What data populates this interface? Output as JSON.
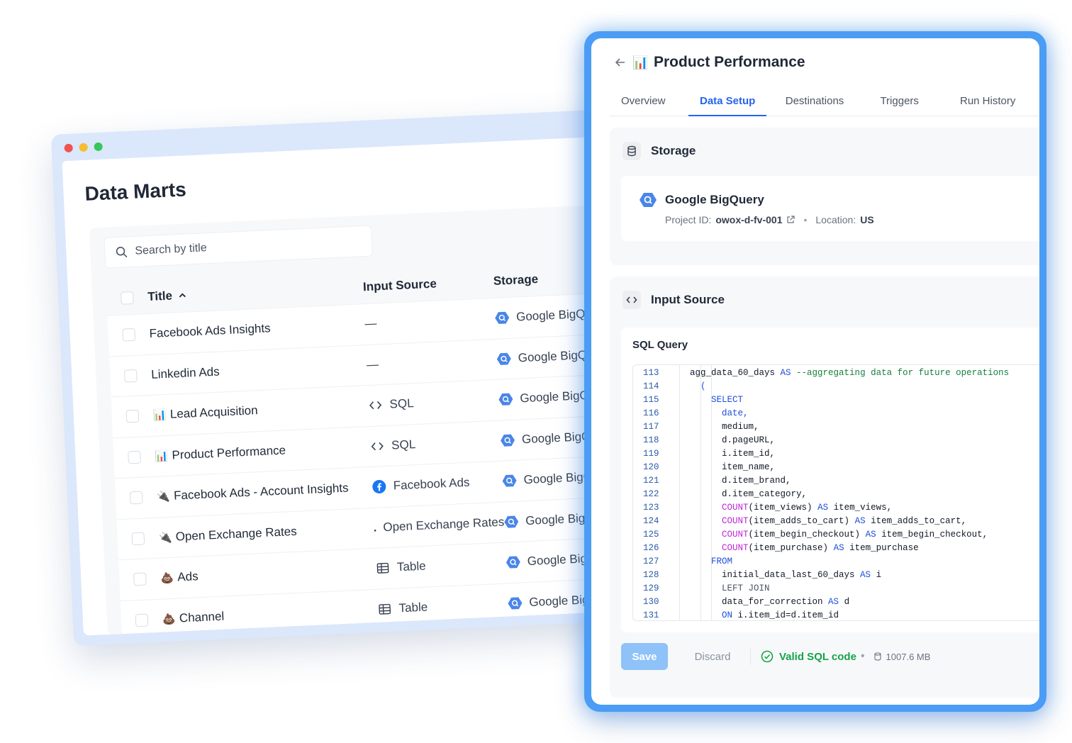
{
  "data_marts": {
    "title": "Data Marts",
    "search_placeholder": "Search by title",
    "columns": {
      "title": "Title",
      "input_source": "Input Source",
      "storage": "Storage"
    },
    "rows": [
      {
        "emoji": "",
        "title": "Facebook Ads Insights",
        "input_icon": "none",
        "input": "—",
        "storage": "Google BigQuery"
      },
      {
        "emoji": "",
        "title": "Linkedin Ads",
        "input_icon": "none",
        "input": "—",
        "storage": "Google BigQuery"
      },
      {
        "emoji": "📊",
        "title": "Lead Acquisition",
        "input_icon": "code-icon",
        "input": "SQL",
        "storage": "Google BigQuery"
      },
      {
        "emoji": "📊",
        "title": "Product Performance",
        "input_icon": "code-icon",
        "input": "SQL",
        "storage": "Google BigQuery"
      },
      {
        "emoji": "🔌",
        "title": "Facebook Ads - Account Insights",
        "input_icon": "facebook-icon",
        "input": "Facebook Ads",
        "storage": "Google BigQuery"
      },
      {
        "emoji": "🔌",
        "title": "Open Exchange Rates",
        "input_icon": "globe-icon",
        "input": "Open Exchange Rates",
        "storage": "Google BigQuery"
      },
      {
        "emoji": "💩",
        "title": "Ads",
        "input_icon": "table-icon",
        "input": "Table",
        "storage": "Google BigQuery"
      },
      {
        "emoji": "💩",
        "title": "Channel",
        "input_icon": "table-icon",
        "input": "Table",
        "storage": "Google BigQuery"
      }
    ]
  },
  "panel": {
    "emoji": "📊",
    "title": "Product Performance",
    "tabs": [
      "Overview",
      "Data Setup",
      "Destinations",
      "Triggers",
      "Run History"
    ],
    "active_tab": "Data Setup",
    "storage": {
      "heading": "Storage",
      "name": "Google BigQuery",
      "project_label": "Project ID:",
      "project_id": "owox-d-fv-001",
      "location_label": "Location:",
      "location": "US"
    },
    "input_source": {
      "heading": "Input Source",
      "sql_label": "SQL Query",
      "line_numbers": [
        "113",
        "114",
        "115",
        "116",
        "117",
        "118",
        "119",
        "120",
        "121",
        "122",
        "123",
        "124",
        "125",
        "126",
        "127",
        "128",
        "129",
        "130",
        "131"
      ],
      "lines": [
        [
          {
            "t": "agg_data_60_days ",
            "c": ""
          },
          {
            "t": "AS",
            "c": "kw"
          },
          {
            "t": " --aggregating data for future operations",
            "c": "cm"
          }
        ],
        [
          {
            "t": "  (",
            "c": "kw"
          }
        ],
        [
          {
            "t": "    SELECT",
            "c": "kw"
          }
        ],
        [
          {
            "t": "      date,",
            "c": "kw2"
          }
        ],
        [
          {
            "t": "      medium,",
            "c": ""
          }
        ],
        [
          {
            "t": "      d.pageURL,",
            "c": ""
          }
        ],
        [
          {
            "t": "      i.item_id,",
            "c": ""
          }
        ],
        [
          {
            "t": "      item_name,",
            "c": ""
          }
        ],
        [
          {
            "t": "      d.item_brand,",
            "c": ""
          }
        ],
        [
          {
            "t": "      d.item_category,",
            "c": ""
          }
        ],
        [
          {
            "t": "      ",
            "c": ""
          },
          {
            "t": "COUNT",
            "c": "fn"
          },
          {
            "t": "(item_views) ",
            "c": ""
          },
          {
            "t": "AS",
            "c": "kw"
          },
          {
            "t": " item_views,",
            "c": ""
          }
        ],
        [
          {
            "t": "      ",
            "c": ""
          },
          {
            "t": "COUNT",
            "c": "fn"
          },
          {
            "t": "(item_adds_to_cart) ",
            "c": ""
          },
          {
            "t": "AS",
            "c": "kw"
          },
          {
            "t": " item_adds_to_cart,",
            "c": ""
          }
        ],
        [
          {
            "t": "      ",
            "c": ""
          },
          {
            "t": "COUNT",
            "c": "fn"
          },
          {
            "t": "(item_begin_checkout) ",
            "c": ""
          },
          {
            "t": "AS",
            "c": "kw"
          },
          {
            "t": " item_begin_checkout,",
            "c": ""
          }
        ],
        [
          {
            "t": "      ",
            "c": ""
          },
          {
            "t": "COUNT",
            "c": "fn"
          },
          {
            "t": "(item_purchase) ",
            "c": ""
          },
          {
            "t": "AS",
            "c": "kw"
          },
          {
            "t": " item_purchase",
            "c": ""
          }
        ],
        [
          {
            "t": "    FROM",
            "c": "kw"
          }
        ],
        [
          {
            "t": "      initial_data_last_60_days ",
            "c": ""
          },
          {
            "t": "AS",
            "c": "kw"
          },
          {
            "t": " i",
            "c": ""
          }
        ],
        [
          {
            "t": "      LEFT JOIN",
            "c": "gray"
          }
        ],
        [
          {
            "t": "      data_for_correction ",
            "c": ""
          },
          {
            "t": "AS",
            "c": "kw"
          },
          {
            "t": " d",
            "c": ""
          }
        ],
        [
          {
            "t": "      ",
            "c": ""
          },
          {
            "t": "ON",
            "c": "kw"
          },
          {
            "t": " i.item_id=d.item_id",
            "c": ""
          }
        ]
      ]
    },
    "actions": {
      "save": "Save",
      "discard": "Discard",
      "status": "Valid SQL code",
      "size": "1007.6 MB"
    }
  },
  "colors": {
    "accent": "#2563eb",
    "glow": "#4a9cf5",
    "valid": "#16a34a",
    "save_disabled": "#8ec2f8"
  }
}
